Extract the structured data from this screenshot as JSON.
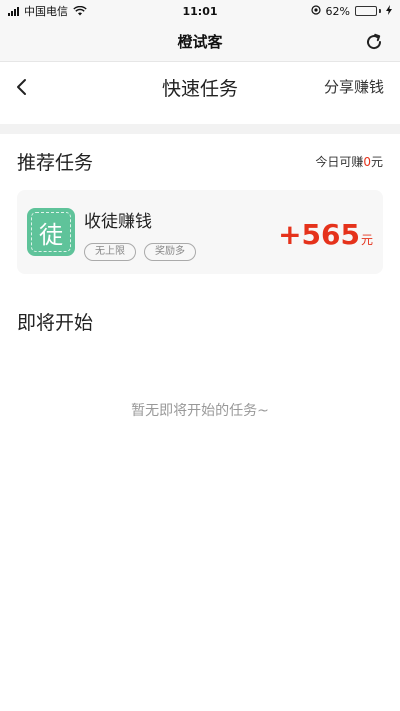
{
  "status_bar": {
    "carrier": "中国电信",
    "time": "11:01",
    "battery_percent": "62%",
    "battery_level": 0.62
  },
  "app": {
    "title": "橙试客"
  },
  "header": {
    "title": "快速任务",
    "share_label": "分享赚钱"
  },
  "recommended": {
    "title": "推荐任务",
    "today_prefix": "今日可赚",
    "today_amount": "0",
    "today_unit": "元",
    "tasks": [
      {
        "icon_char": "徒",
        "name": "收徒赚钱",
        "tags": [
          "无上限",
          "奖励多"
        ],
        "reward_amount": "+565",
        "reward_unit": "元"
      }
    ]
  },
  "upcoming": {
    "title": "即将开始",
    "empty_text": "暂无即将开始的任务~"
  },
  "colors": {
    "accent_red": "#e5321b",
    "icon_green": "#5fc39a"
  }
}
